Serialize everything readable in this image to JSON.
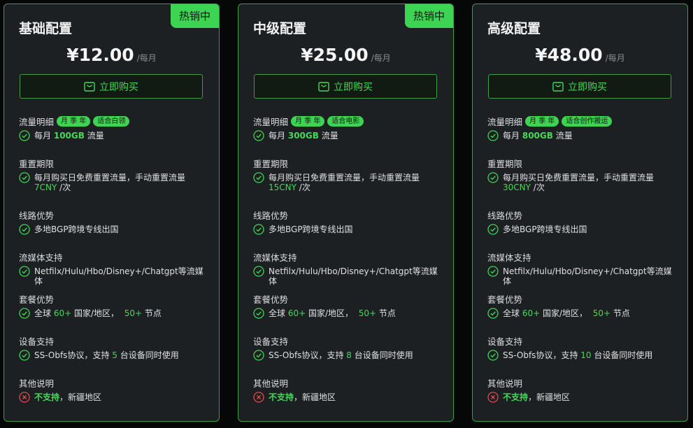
{
  "buy_label": "立即购买",
  "per_label": "/每月",
  "sections": {
    "traffic": "流量明细",
    "reset": "重置期限",
    "route": "线路优势",
    "media": "流媒体支持",
    "plan": "套餐优势",
    "device": "设备支持",
    "other": "其他说明"
  },
  "common": {
    "traffic_tag": "月 季 年",
    "traffic_prefix": "每月",
    "traffic_suffix": "流量",
    "reset_text": "每月购买日免费重置流量，手动重置流量",
    "reset_suffix": "/次",
    "route_text": "多地BGP跨境专线出国",
    "media_text": "Netfilx/Hulu/Hbo/Disney+/Chatgpt等流媒体",
    "plan_pre": "全球",
    "plan_n1": "60+",
    "plan_mid": "国家/地区，",
    "plan_n2": "50+",
    "plan_post": "节点",
    "device_pre": "SS-Obfs协议，支持",
    "device_post": "台设备同时使用",
    "other_bold": "不支持",
    "other_rest": "，新疆地区"
  },
  "plans": [
    {
      "name": "基础配置",
      "price": "¥12.00",
      "badge": "热销中",
      "tag2": "适合白领",
      "traffic": "100GB",
      "reset_fee": "7CNY",
      "devices": "5"
    },
    {
      "name": "中级配置",
      "price": "¥25.00",
      "badge": "热销中",
      "tag2": "适合电影",
      "traffic": "300GB",
      "reset_fee": "15CNY",
      "devices": "8"
    },
    {
      "name": "高级配置",
      "price": "¥48.00",
      "badge": "",
      "tag2": "适合创作搬运",
      "traffic": "800GB",
      "reset_fee": "30CNY",
      "devices": "10"
    }
  ],
  "colors": {
    "accent": "#3ed453",
    "card_bg": "#1d2023",
    "error": "#e5484d"
  }
}
